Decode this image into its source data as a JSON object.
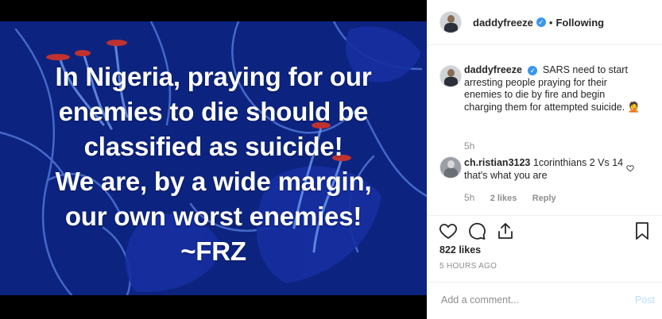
{
  "post": {
    "image_text_lines": [
      "In Nigeria, praying for our",
      "enemies to die should be",
      "classified as suicide!",
      "We are, by a wide margin,",
      "our own worst enemies!",
      "~FRZ"
    ],
    "image_bg_color": "#0c2480"
  },
  "header": {
    "username": "daddyfreeze",
    "separator": "•",
    "follow_status": "Following"
  },
  "caption": {
    "username": "daddyfreeze",
    "text": "SARS need to start arresting people praying for their enemies to die by fire and begin charging them for attempted suicide. 🤦",
    "time": "5h"
  },
  "comment": {
    "username": "ch.ristian3123",
    "text": "1corinthians 2 Vs 14 that's what you are",
    "time": "5h",
    "likes": "2 likes",
    "reply": "Reply"
  },
  "stats": {
    "likes": "822 likes",
    "time_ago": "5 HOURS AGO"
  },
  "add_comment": {
    "placeholder": "Add a comment...",
    "post_label": "Post"
  },
  "colors": {
    "verified": "#3897f0",
    "post_button_disabled": "#b2dffc",
    "muted_text": "#8e8e8e"
  }
}
